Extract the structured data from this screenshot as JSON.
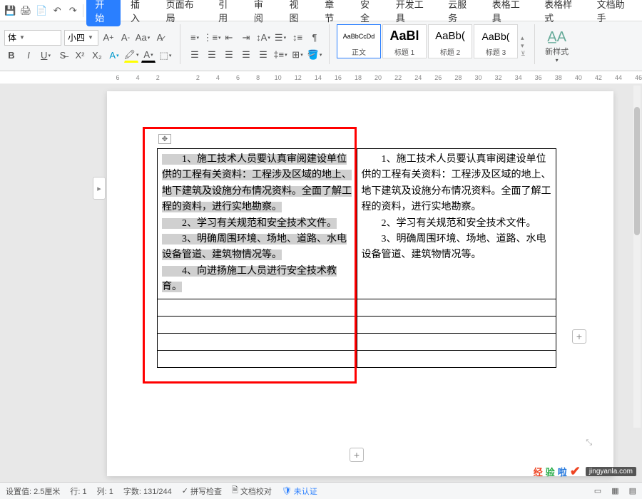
{
  "menu": {
    "tabs": [
      "开始",
      "插入",
      "页面布局",
      "引用",
      "审阅",
      "视图",
      "章节",
      "安全",
      "开发工具",
      "云服务",
      "表格工具",
      "表格样式",
      "文档助手"
    ],
    "active_index": 0
  },
  "ribbon": {
    "font_name": "体",
    "font_size": "小四",
    "styles": [
      {
        "preview": "AaBbCcDd",
        "label": "正文",
        "preview_size": "9px"
      },
      {
        "preview": "AaBl",
        "label": "标题 1",
        "preview_size": "18px",
        "bold": true
      },
      {
        "preview": "AaBb(",
        "label": "标题 2",
        "preview_size": "15px"
      },
      {
        "preview": "AaBb(",
        "label": "标题 3",
        "preview_size": "14px"
      }
    ],
    "newstyle_label": "新样式"
  },
  "ruler": [
    "6",
    "4",
    "2",
    "",
    "2",
    "4",
    "6",
    "8",
    "10",
    "12",
    "14",
    "16",
    "18",
    "20",
    "22",
    "24",
    "26",
    "28",
    "30",
    "32",
    "34",
    "36",
    "38",
    "40",
    "42",
    "44",
    "46"
  ],
  "document": {
    "cell_left": "　　1、施工技术人员要认真审阅建设单位供的工程有关资料：工程涉及区域的地上、地下建筑及设施分布情况资料。全面了解工程的资料，进行实地勘察。\n　　2、学习有关规范和安全技术文件。\n　　3、明确周围环境、场地、道路、水电设备管道、建筑物情况等。\n　　4、向进扬施工人员进行安全技术教育。",
    "cell_right": "　　1、施工技术人员要认真审阅建设单位供的工程有关资料：工程涉及区域的地上、地下建筑及设施分布情况资料。全面了解工程的资料，进行实地勘察。\n　　2、学习有关规范和安全技术文件。\n　　3、明确周围环境、场地、道路、水电设备管道、建筑物情况等。"
  },
  "status": {
    "indent": "设置值: 2.5厘米",
    "row": "行: 1",
    "col": "列: 1",
    "words": "字数: 131/244",
    "spell": "拼写检查",
    "proof": "文档校对",
    "auth": "未认证"
  },
  "watermark": {
    "t1": "经",
    "t2": "验",
    "t3": "啦",
    "url": "jingyanla.com"
  }
}
